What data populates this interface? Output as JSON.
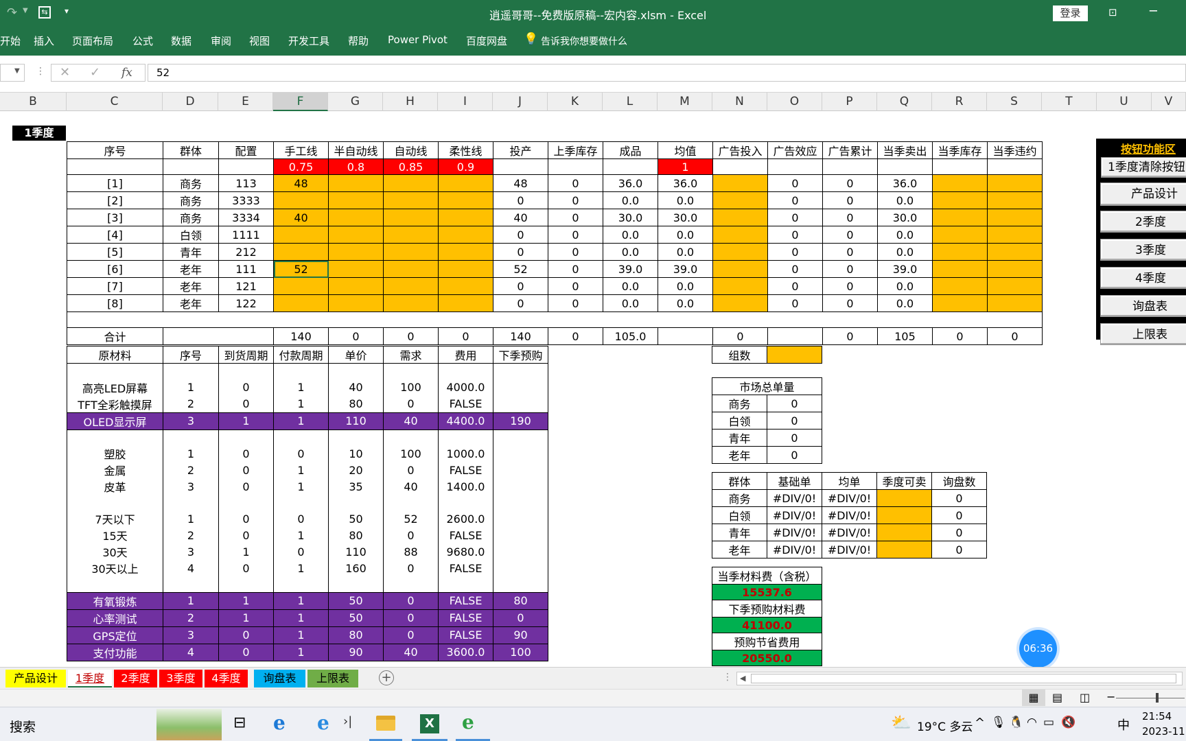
{
  "app": {
    "title": "逍遥哥哥--免费版原稿--宏内容.xlsm  -  Excel",
    "login_label": "登录",
    "ribbon": [
      "开始",
      "插入",
      "页面布局",
      "公式",
      "数据",
      "审阅",
      "视图",
      "开发工具",
      "帮助",
      "Power Pivot",
      "百度网盘"
    ],
    "tell_me": "告诉我你想要做什么"
  },
  "formula": {
    "value": "52",
    "fx": "fx"
  },
  "columns": [
    "B",
    "C",
    "D",
    "E",
    "F",
    "G",
    "H",
    "I",
    "J",
    "K",
    "L",
    "M",
    "N",
    "O",
    "P",
    "Q",
    "R",
    "S",
    "T",
    "U",
    "V"
  ],
  "season_label": "1季度",
  "main_table": {
    "headers": [
      "序号",
      "群体",
      "配置",
      "手工线",
      "半自动线",
      "自动线",
      "柔性线",
      "投产",
      "上季库存",
      "成品",
      "均值",
      "广告投入",
      "广告效应",
      "广告累计",
      "当季卖出",
      "当季库存",
      "当季违约"
    ],
    "factors": [
      "0.75",
      "0.8",
      "0.85",
      "0.9"
    ],
    "avg_factor": "1",
    "rows": [
      [
        "[1]",
        "商务",
        "113",
        "48",
        "",
        "",
        "",
        "48",
        "0",
        "36.0",
        "36.0",
        "",
        "0",
        "0",
        "36.0",
        "",
        ""
      ],
      [
        "[2]",
        "商务",
        "3333",
        "",
        "",
        "",
        "",
        "0",
        "0",
        "0.0",
        "0.0",
        "",
        "0",
        "0",
        "0.0",
        "",
        ""
      ],
      [
        "[3]",
        "商务",
        "3334",
        "40",
        "",
        "",
        "",
        "40",
        "0",
        "30.0",
        "30.0",
        "",
        "0",
        "0",
        "30.0",
        "",
        ""
      ],
      [
        "[4]",
        "白领",
        "1111",
        "",
        "",
        "",
        "",
        "0",
        "0",
        "0.0",
        "0.0",
        "",
        "0",
        "0",
        "0.0",
        "",
        ""
      ],
      [
        "[5]",
        "青年",
        "212",
        "",
        "",
        "",
        "",
        "0",
        "0",
        "0.0",
        "0.0",
        "",
        "0",
        "0",
        "0.0",
        "",
        ""
      ],
      [
        "[6]",
        "老年",
        "111",
        "52",
        "",
        "",
        "",
        "52",
        "0",
        "39.0",
        "39.0",
        "",
        "0",
        "0",
        "39.0",
        "",
        ""
      ],
      [
        "[7]",
        "老年",
        "121",
        "",
        "",
        "",
        "",
        "0",
        "0",
        "0.0",
        "0.0",
        "",
        "0",
        "0",
        "0.0",
        "",
        ""
      ],
      [
        "[8]",
        "老年",
        "122",
        "",
        "",
        "",
        "",
        "0",
        "0",
        "0.0",
        "0.0",
        "",
        "0",
        "0",
        "0.0",
        "",
        ""
      ]
    ],
    "total": [
      "合计",
      "",
      "",
      "140",
      "0",
      "0",
      "0",
      "140",
      "0",
      "105.0",
      "",
      "0",
      "",
      "0",
      "105",
      "0",
      "0"
    ]
  },
  "material_table": {
    "headers": [
      "原材料",
      "序号",
      "到货周期",
      "付款周期",
      "单价",
      "需求",
      "费用",
      "下季预购"
    ],
    "groups": [
      {
        "style": "plain",
        "rows": [
          [
            "高亮LED屏幕",
            "1",
            "0",
            "1",
            "40",
            "100",
            "4000.0",
            ""
          ],
          [
            "TFT全彩触摸屏",
            "2",
            "0",
            "1",
            "80",
            "0",
            "FALSE",
            ""
          ]
        ]
      },
      {
        "style": "purple",
        "rows": [
          [
            "OLED显示屏",
            "3",
            "1",
            "1",
            "110",
            "40",
            "4400.0",
            "190"
          ]
        ]
      },
      {
        "style": "plain",
        "rows": [
          [
            "塑胶",
            "1",
            "0",
            "0",
            "10",
            "100",
            "1000.0",
            ""
          ],
          [
            "金属",
            "2",
            "0",
            "1",
            "20",
            "0",
            "FALSE",
            ""
          ],
          [
            "皮革",
            "3",
            "0",
            "1",
            "35",
            "40",
            "1400.0",
            ""
          ]
        ]
      },
      {
        "style": "plain",
        "rows": [
          [
            "7天以下",
            "1",
            "0",
            "0",
            "50",
            "52",
            "2600.0",
            ""
          ],
          [
            "15天",
            "2",
            "0",
            "1",
            "80",
            "0",
            "FALSE",
            ""
          ],
          [
            "30天",
            "3",
            "1",
            "0",
            "110",
            "88",
            "9680.0",
            ""
          ],
          [
            "30天以上",
            "4",
            "0",
            "1",
            "160",
            "0",
            "FALSE",
            ""
          ]
        ]
      },
      {
        "style": "purple",
        "rows": [
          [
            "有氧锻炼",
            "1",
            "1",
            "1",
            "50",
            "0",
            "FALSE",
            "80"
          ],
          [
            "心率测试",
            "2",
            "1",
            "1",
            "50",
            "0",
            "FALSE",
            "0"
          ],
          [
            "GPS定位",
            "3",
            "0",
            "1",
            "80",
            "0",
            "FALSE",
            "90"
          ],
          [
            "支付功能",
            "4",
            "0",
            "1",
            "90",
            "40",
            "3600.0",
            "100"
          ]
        ]
      }
    ]
  },
  "groups_count_label": "组数",
  "market_total": {
    "title": "市场总单量",
    "rows": [
      [
        "商务",
        "0"
      ],
      [
        "白领",
        "0"
      ],
      [
        "青年",
        "0"
      ],
      [
        "老年",
        "0"
      ]
    ]
  },
  "group_stats": {
    "headers": [
      "群体",
      "基础单",
      "均单",
      "季度可卖",
      "询盘数"
    ],
    "rows": [
      [
        "商务",
        "#DIV/0!",
        "#DIV/0!",
        "",
        "0"
      ],
      [
        "白领",
        "#DIV/0!",
        "#DIV/0!",
        "",
        "0"
      ],
      [
        "青年",
        "#DIV/0!",
        "#DIV/0!",
        "",
        "0"
      ],
      [
        "老年",
        "#DIV/0!",
        "#DIV/0!",
        "",
        "0"
      ]
    ]
  },
  "costs": [
    {
      "label": "当季材料费（含税）",
      "value": "15537.6"
    },
    {
      "label": "下季预购材料费",
      "value": "41100.0"
    },
    {
      "label": "预购节省费用",
      "value": "20550.0"
    }
  ],
  "button_panel": {
    "title": "按钮功能区",
    "buttons": [
      "1季度清除按钮",
      "产品设计",
      "2季度",
      "3季度",
      "4季度",
      "询盘表",
      "上限表"
    ]
  },
  "timer": "06:36",
  "sheet_tabs": [
    {
      "label": "产品设计",
      "color": "#ffff00",
      "text": "#000000"
    },
    {
      "label": "1季度",
      "color": "#ffffff",
      "text": "#c00000"
    },
    {
      "label": "2季度",
      "color": "#ff0000",
      "text": "#ffffff"
    },
    {
      "label": "3季度",
      "color": "#ff0000",
      "text": "#ffffff"
    },
    {
      "label": "4季度",
      "color": "#ff0000",
      "text": "#ffffff"
    },
    {
      "label": "询盘表",
      "color": "#00b0f0",
      "text": "#000000"
    },
    {
      "label": "上限表",
      "color": "#70ad47",
      "text": "#000000"
    }
  ],
  "taskbar": {
    "search": "搜索",
    "weather": "19°C 多云",
    "ime": "中",
    "time": "21:54",
    "date": "2023-11"
  }
}
